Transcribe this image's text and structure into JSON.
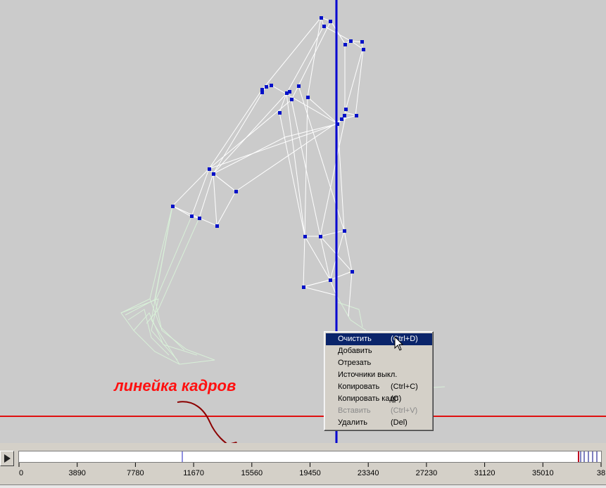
{
  "annotation": {
    "label": "линейка кадров"
  },
  "context_menu": {
    "items": [
      {
        "label": "Очистить",
        "shortcut": "(Ctrl+D)",
        "state": "selected"
      },
      {
        "label": "Добавить",
        "shortcut": "",
        "state": "normal"
      },
      {
        "label": "Отрезать",
        "shortcut": "",
        "state": "normal"
      },
      {
        "label": "Источники выкл.",
        "shortcut": "",
        "state": "normal"
      },
      {
        "label": "Копировать",
        "shortcut": "(Ctrl+C)",
        "state": "normal"
      },
      {
        "label": "Копировать кадр",
        "shortcut": "(C)",
        "state": "normal"
      },
      {
        "label": "Вставить",
        "shortcut": "(Ctrl+V)",
        "state": "disabled"
      },
      {
        "label": "Удалить",
        "shortcut": "(Del)",
        "state": "normal"
      }
    ]
  },
  "timeline": {
    "play_icon": "play-icon",
    "ticks": [
      "0",
      "3890",
      "7780",
      "11670",
      "15560",
      "19450",
      "23340",
      "27230",
      "31120",
      "35010",
      "38"
    ]
  },
  "colors": {
    "viewport_bg": "#cbcbcb",
    "skeleton_lines": "#ffffff",
    "mesh_lines": "#d8f0d8",
    "joints": "#0010c8",
    "frame_cursor": "#0000d0",
    "ground_line": "#e01010",
    "annotation": "#ff1010",
    "arrow": "#8b0000",
    "menu_highlight": "#0a246a"
  }
}
